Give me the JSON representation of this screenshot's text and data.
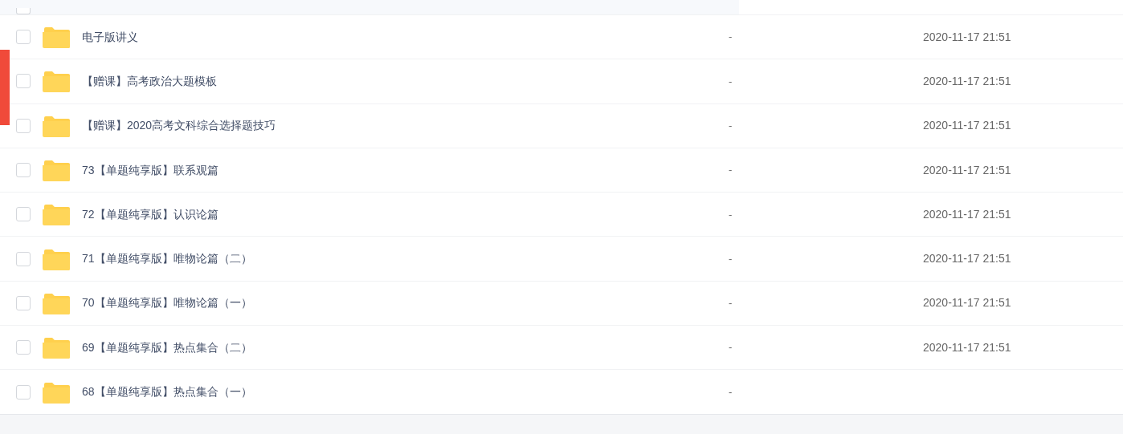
{
  "rows": [
    {
      "name": "电子版讲义",
      "size": "-",
      "modified": "2020-11-17 21:51",
      "checked": false
    },
    {
      "name": "【赠课】高考政治大题模板",
      "size": "-",
      "modified": "2020-11-17 21:51",
      "checked": false
    },
    {
      "name": "【赠课】2020高考文科综合选择题技巧",
      "size": "-",
      "modified": "2020-11-17 21:51",
      "checked": false
    },
    {
      "name": "73【单题纯享版】联系观篇",
      "size": "-",
      "modified": "2020-11-17 21:51",
      "checked": false
    },
    {
      "name": "72【单题纯享版】认识论篇",
      "size": "-",
      "modified": "2020-11-17 21:51",
      "checked": false
    },
    {
      "name": "71【单题纯享版】唯物论篇（二）",
      "size": "-",
      "modified": "2020-11-17 21:51",
      "checked": false
    },
    {
      "name": "70【单题纯享版】唯物论篇（一）",
      "size": "-",
      "modified": "2020-11-17 21:51",
      "checked": false
    },
    {
      "name": "69【单题纯享版】热点集合（二）",
      "size": "-",
      "modified": "2020-11-17 21:51",
      "checked": false
    },
    {
      "name": "68【单题纯享版】热点集合（一）",
      "size": "-",
      "checked": false
    }
  ]
}
